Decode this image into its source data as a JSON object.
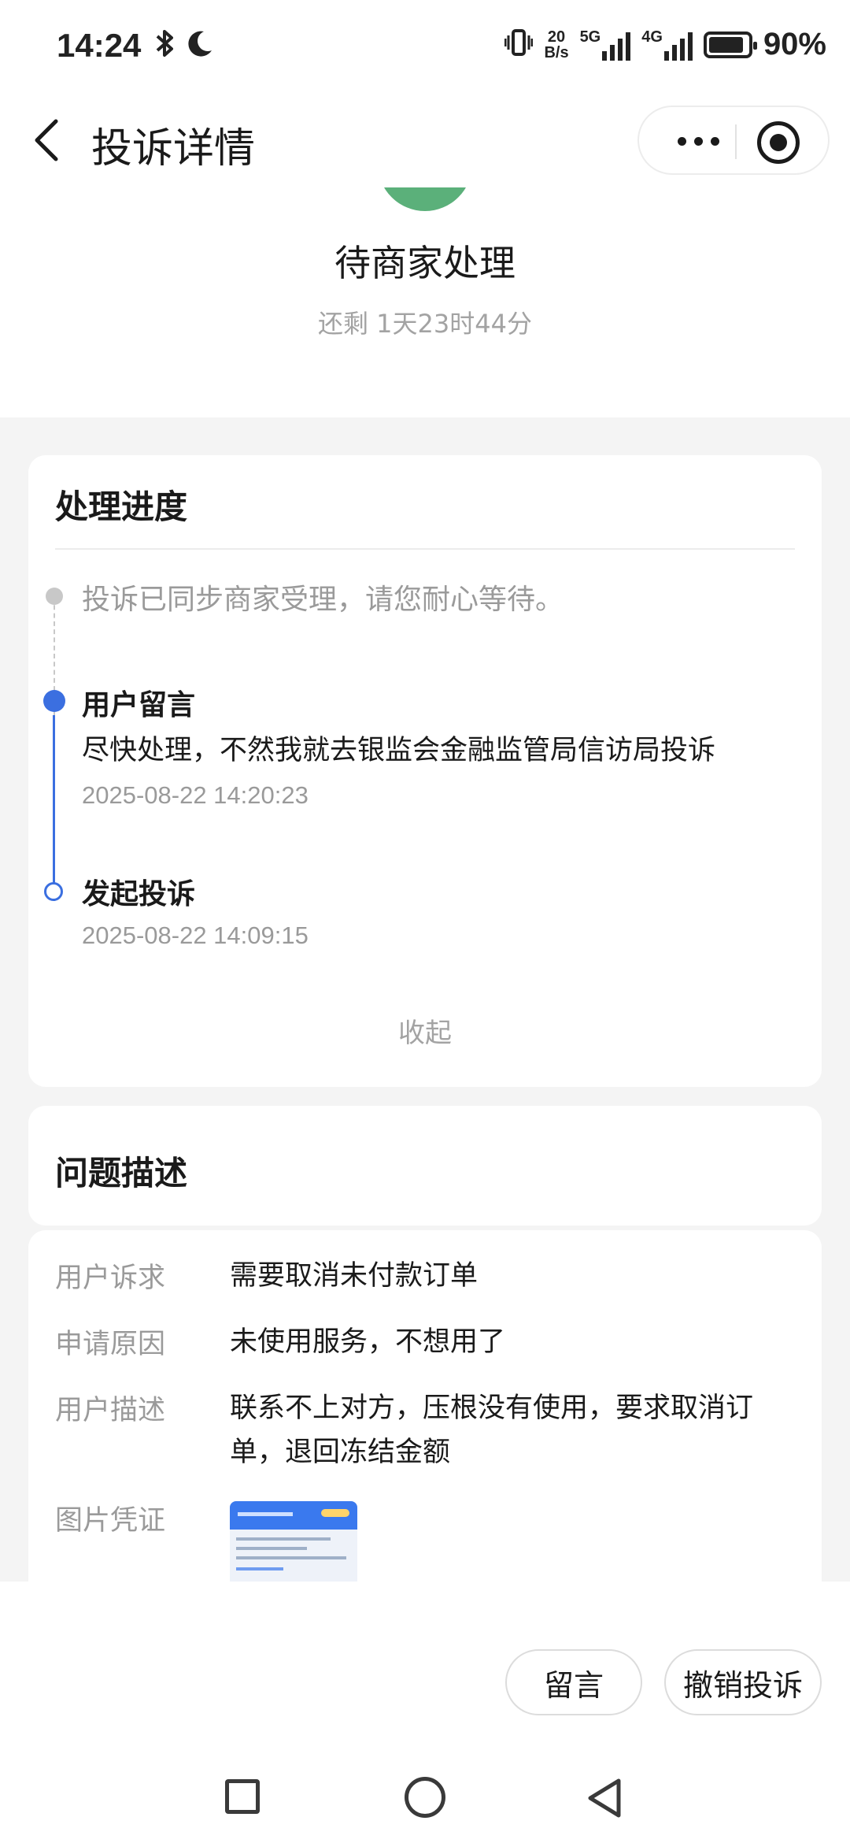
{
  "status_bar": {
    "time": "14:24",
    "net_speed_top": "20",
    "net_speed_bottom": "B/s",
    "sig1_label": "5G",
    "sig2_label": "4G",
    "battery_percent": "90%",
    "battery_level": 0.9
  },
  "nav": {
    "title": "投诉详情"
  },
  "status": {
    "title": "待商家处理",
    "remaining": "还剩 1天23时44分"
  },
  "progress": {
    "title": "处理进度",
    "items": [
      {
        "text": "投诉已同步商家受理，请您耐心等待。"
      },
      {
        "title": "用户留言",
        "body": "尽快处理，不然我就去银监会金融监管局信访局投诉",
        "time": "2025-08-22 14:20:23"
      },
      {
        "title": "发起投诉",
        "time": "2025-08-22 14:09:15"
      }
    ],
    "collapse_label": "收起"
  },
  "description": {
    "title": "问题描述",
    "rows": [
      {
        "label": "用户诉求",
        "value": "需要取消未付款订单"
      },
      {
        "label": "申请原因",
        "value": "未使用服务，不想用了"
      },
      {
        "label": "用户描述",
        "value": "联系不上对方，压根没有使用，要求取消订单，退回冻结金额"
      },
      {
        "label": "图片凭证",
        "value": ""
      }
    ]
  },
  "actions": {
    "message_label": "留言",
    "revoke_label": "撤销投诉"
  },
  "colors": {
    "accent": "#3b6fe0",
    "status_icon": "#5bb07a"
  }
}
